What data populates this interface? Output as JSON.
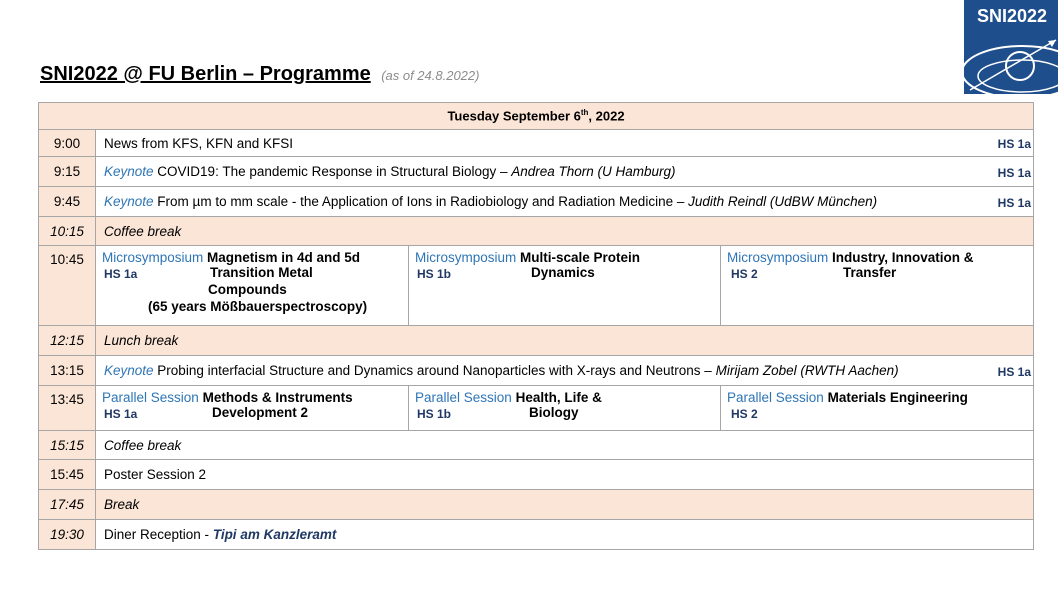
{
  "header": {
    "title": "SNI2022 @ FU Berlin – Programme",
    "as_of": "(as of 24.8.2022)",
    "logo_text": "SNI2022"
  },
  "day": {
    "label_pre": "Tuesday September 6",
    "label_sup": "th",
    "label_post": ", 2022"
  },
  "rows": [
    {
      "time": "9:00",
      "text": "News from KFS, KFN and KFSI",
      "room": "HS 1a"
    },
    {
      "time": "9:15",
      "kind": "Keynote",
      "text": " COVID19: The pandemic Response in Structural Biology  – ",
      "speaker": "Andrea Thorn (U Hamburg)",
      "room": "HS 1a"
    },
    {
      "time": "9:45",
      "kind": "Keynote",
      "text": " From µm to mm scale - the Application of Ions in Radiobiology and Radiation Medicine – ",
      "speaker": "Judith Reindl (UdBW München)",
      "room": "HS 1a"
    },
    {
      "time": "10:15",
      "text": "Coffee break"
    },
    {
      "time": "10:45",
      "sessions": [
        {
          "kind": "Microsymposium",
          "title_1": "Magnetism in 4d and 5d",
          "title_2": "Transition Metal",
          "title_3": "Compounds",
          "title_4": "(65 years Mößbauerspectroscopy)",
          "room": "HS 1a"
        },
        {
          "kind": "Microsymposium",
          "title_1": "Multi-scale Protein",
          "title_2": "Dynamics",
          "room": "HS 1b"
        },
        {
          "kind": "Microsymposium",
          "title_1": "Industry, Innovation &",
          "title_2": "Transfer",
          "room": "HS 2"
        }
      ]
    },
    {
      "time": "12:15",
      "text": "Lunch break"
    },
    {
      "time": "13:15",
      "kind": "Keynote",
      "text": " Probing interfacial Structure and Dynamics around Nanoparticles with X-rays and Neutrons – ",
      "speaker": "Mirijam Zobel (RWTH Aachen)",
      "room": "HS 1a"
    },
    {
      "time": "13:45",
      "sessions": [
        {
          "kind": "Parallel Session",
          "title_1": "Methods & Instruments",
          "title_2": "Development 2",
          "room": "HS 1a"
        },
        {
          "kind": "Parallel Session",
          "title_1": "Health, Life &",
          "title_2": "Biology",
          "room": "HS 1b"
        },
        {
          "kind": "Parallel Session",
          "title_1": "Materials Engineering",
          "room": "HS 2"
        }
      ]
    },
    {
      "time": "15:15",
      "text": "Coffee break"
    },
    {
      "time": "15:45",
      "text": "Poster Session 2"
    },
    {
      "time": "17:45",
      "text": "Break"
    },
    {
      "time": "19:30",
      "text": "Diner Reception - ",
      "venue": "Tipi am Kanzleramt"
    }
  ]
}
